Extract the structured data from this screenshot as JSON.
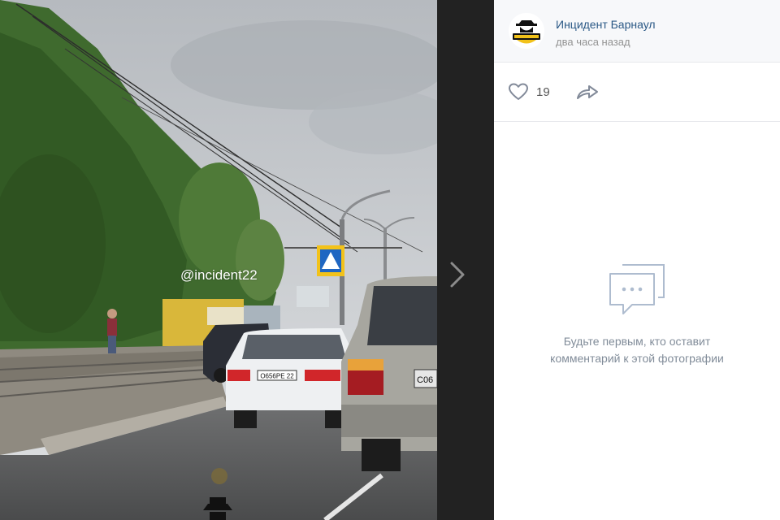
{
  "photo": {
    "watermark": "@incident22",
    "plate_front": "О656РЕ 22",
    "plate_suv": "С06"
  },
  "post": {
    "author": "Инцидент Барнаул",
    "time": "два часа назад",
    "avatar_text": "ИНЦИДЕНТ БАРНАУЛ"
  },
  "actions": {
    "like_count": "19"
  },
  "comments": {
    "empty_line1": "Будьте первым, кто оставит",
    "empty_line2": "комментарий к этой фотографии"
  },
  "colors": {
    "link": "#2a5885",
    "muted": "#939393",
    "empty_text": "#818c99"
  },
  "icons": [
    "heart-icon",
    "share-icon",
    "chevron-right-icon",
    "comment-bubble-icon",
    "detective-logo-icon"
  ]
}
